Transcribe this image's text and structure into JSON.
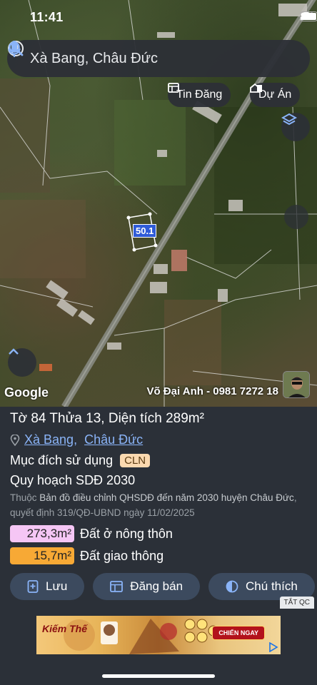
{
  "status_bar": {
    "time": "11:41"
  },
  "search": {
    "query": "Xà Bang, Châu Đức"
  },
  "map": {
    "chips": {
      "listings": "Tin Đăng",
      "projects": "Dự Án"
    },
    "parcel_label": "50.1",
    "google_logo": "Google",
    "contact": "Võ Đại Anh - 0981 7272 18"
  },
  "parcel": {
    "title": "Tờ 84 Thửa 13, Diện tích 289m²",
    "commune": "Xà Bang",
    "separator": ",",
    "district": "Châu Đức",
    "purpose_label": "Mục đích sử dụng",
    "purpose_code": "CLN",
    "plan_title": "Quy hoạch SDĐ 2030",
    "plan_prefix": "Thuộc",
    "plan_map": "Bản đồ điều chỉnh QHSDĐ đến năm 2030 huyện Châu Đức",
    "plan_decision": ", quyết định 319/QĐ-UBND ngày 11/02/2025",
    "areas": [
      {
        "value": "273,3m²",
        "label": "Đất ở nông thôn",
        "color": "#f5c6f5"
      },
      {
        "value": "15,7m²",
        "label": "Đất giao thông",
        "color": "#f7a935"
      }
    ]
  },
  "actions": {
    "save": "Lưu",
    "post": "Đăng bán",
    "legend": "Chú thích"
  },
  "ad": {
    "close_tag": "TẮT QC",
    "cta": "CHIẾN NGAY",
    "logo_text": "Kiếm Thế"
  },
  "colors": {
    "panel_bg": "#2b3038",
    "link": "#8ab4f8",
    "button_bg": "#3c4a5e",
    "accent_blue": "#8ab4f8"
  }
}
